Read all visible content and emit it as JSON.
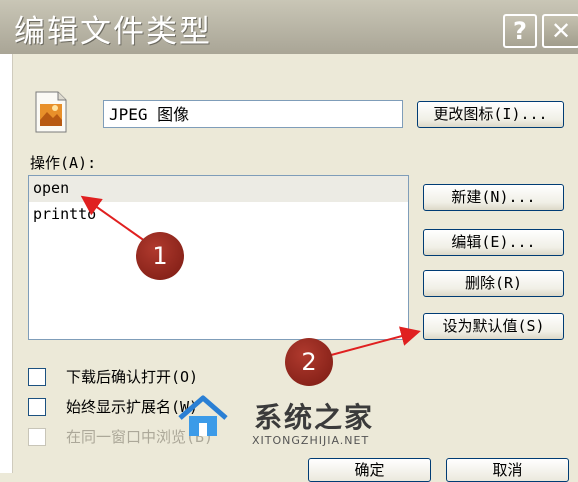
{
  "window": {
    "title": "编辑文件类型"
  },
  "titlebar_icons": {
    "help": "help-icon",
    "close": "close-icon"
  },
  "file_type": {
    "name": "JPEG 图像",
    "icon": "jpeg-file-icon"
  },
  "buttons": {
    "change_icon": "更改图标(I)...",
    "new": "新建(N)...",
    "edit": "编辑(E)...",
    "delete": "删除(R)",
    "set_default": "设为默认值(S)",
    "ok": "确定",
    "cancel": "取消"
  },
  "actions": {
    "label": "操作(A):",
    "items": [
      {
        "label": "open",
        "selected": true
      },
      {
        "label": "printto",
        "selected": false
      }
    ]
  },
  "options": [
    {
      "label": "下载后确认打开(O)",
      "checked": false,
      "enabled": true
    },
    {
      "label": "始终显示扩展名(W)",
      "checked": false,
      "enabled": true
    },
    {
      "label": "在同一窗口中浏览(B)",
      "checked": false,
      "enabled": false
    }
  ],
  "annotations": {
    "marker1": "1",
    "marker2": "2",
    "color": "#e02020"
  },
  "watermark": {
    "title": "系统之家",
    "url": "XITONGZHIJIA.NET"
  }
}
